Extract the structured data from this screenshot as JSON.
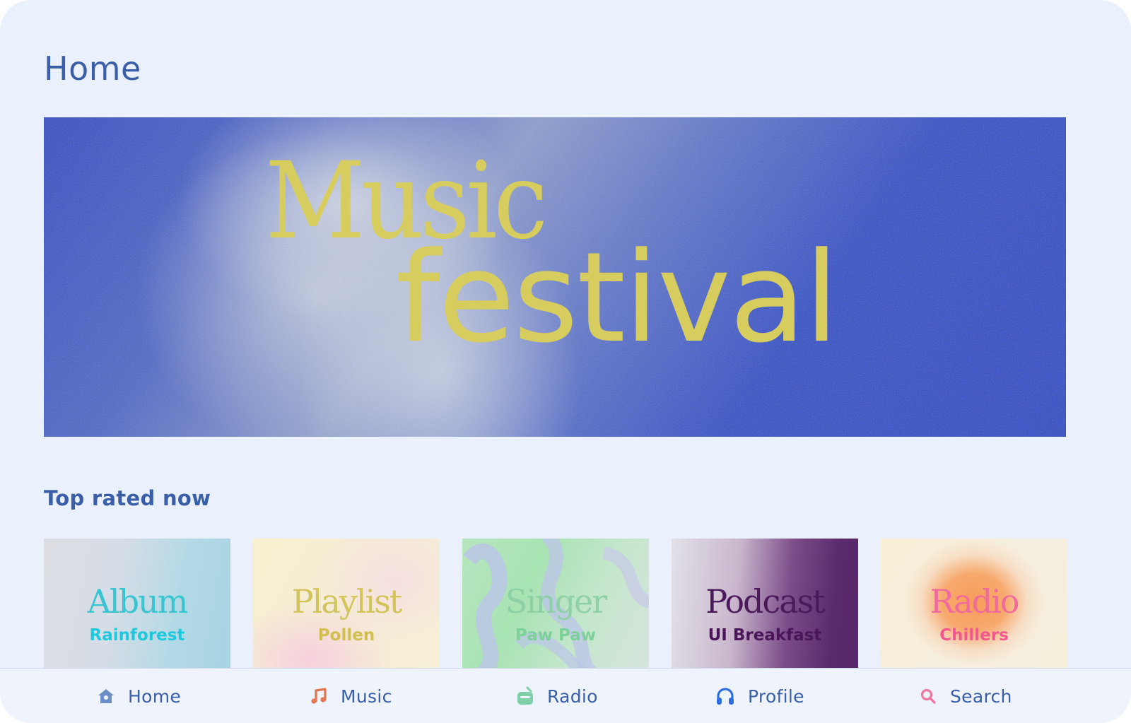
{
  "page": {
    "title": "Home"
  },
  "hero": {
    "line1": "Music",
    "line2": "festival",
    "text_color": "#d7cd5e"
  },
  "top_rated": {
    "title": "Top rated now",
    "cards": [
      {
        "kind": "Album",
        "name": "Rainforest"
      },
      {
        "kind": "Playlist",
        "name": "Pollen"
      },
      {
        "kind": "Singer",
        "name": "Paw Paw"
      },
      {
        "kind": "Podcast",
        "name": "UI Breakfast"
      },
      {
        "kind": "Radio",
        "name": "Chillers"
      }
    ]
  },
  "nav": {
    "items": [
      {
        "label": "Home",
        "icon": "home-icon",
        "color": "#6b8fc6"
      },
      {
        "label": "Music",
        "icon": "music-note-icon",
        "color": "#e2774f"
      },
      {
        "label": "Radio",
        "icon": "radio-icon",
        "color": "#7fcfa9"
      },
      {
        "label": "Profile",
        "icon": "headphones-icon",
        "color": "#2f6fe0"
      },
      {
        "label": "Search",
        "icon": "search-icon",
        "color": "#f0789e"
      }
    ]
  }
}
